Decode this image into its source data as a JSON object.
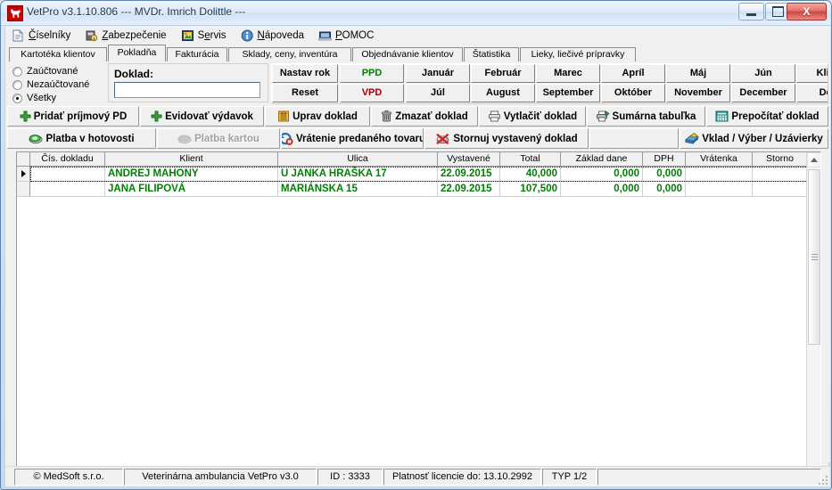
{
  "window": {
    "title": "VetPro v3.1.10.806 --- MVDr. Imrich Dolittle ---",
    "app_icon": "dog-icon",
    "minimize_label": "Minimize",
    "maximize_label": "Maximize",
    "close_label": "X"
  },
  "menu": [
    {
      "label": "Číselníky",
      "icon": "document-icon"
    },
    {
      "label": "Zabezpečenie",
      "icon": "lock-icon"
    },
    {
      "label": "Servis",
      "icon": "tools-icon"
    },
    {
      "label": "Nápoveda",
      "icon": "info-icon"
    },
    {
      "label": "POMOC",
      "icon": "monitor-icon"
    }
  ],
  "tabs": [
    {
      "label": "Kartotéka klientov",
      "active": false
    },
    {
      "label": "Pokladňa",
      "active": true
    },
    {
      "label": "Fakturácia",
      "active": false
    },
    {
      "label": "Sklady, ceny, inventúra",
      "active": false
    },
    {
      "label": "Objednávanie klientov",
      "active": false
    },
    {
      "label": "Štatistika",
      "active": false
    },
    {
      "label": "Lieky, liečivé prípravky",
      "active": false
    }
  ],
  "filter": {
    "options": [
      {
        "label": "Zaúčtované",
        "selected": false
      },
      {
        "label": "Nezaúčtované",
        "selected": false
      },
      {
        "label": "Všetky",
        "selected": true
      }
    ]
  },
  "doklad": {
    "label": "Doklad:",
    "value": "",
    "placeholder": ""
  },
  "grid_buttons": {
    "row1": [
      "Nastav rok",
      "PPD",
      "Január",
      "Február",
      "Marec",
      "Apríl",
      "Máj",
      "Jún",
      "Klien"
    ],
    "row2": [
      "Reset",
      "VPD",
      "Júl",
      "August",
      "September",
      "Október",
      "November",
      "December",
      "Deň"
    ],
    "ppd_color": "#008000",
    "vpd_color": "#a00000"
  },
  "toolbar1": [
    {
      "label": "Pridať príjmový PD",
      "icon": "plus-icon",
      "disabled": false
    },
    {
      "label": "Evidovať výdavok",
      "icon": "plus-icon",
      "disabled": false
    },
    {
      "label": "Uprav doklad",
      "icon": "edit-doc-icon",
      "disabled": false
    },
    {
      "label": "Zmazať doklad",
      "icon": "trash-icon",
      "disabled": false
    },
    {
      "label": "Vytlačiť doklad",
      "icon": "printer-icon",
      "disabled": false
    },
    {
      "label": "Sumárna tabuľka",
      "icon": "printer-green-icon",
      "disabled": false
    },
    {
      "label": "Prepočítať doklad",
      "icon": "calculator-icon",
      "disabled": false
    }
  ],
  "toolbar2": [
    {
      "label": "Platba v hotovosti",
      "icon": "cash-icon",
      "disabled": false
    },
    {
      "label": "Platba kartou",
      "icon": "card-icon",
      "disabled": true
    },
    {
      "label": "Vrátenie predaného tovaru",
      "icon": "return-icon",
      "disabled": false
    },
    {
      "label": "Stornuj vystavený doklad",
      "icon": "cancel-icon",
      "disabled": false
    },
    {
      "label": "",
      "icon": "",
      "disabled": false
    },
    {
      "label": "Vklad / Výber / Uzávierky",
      "icon": "money-icon",
      "disabled": false
    }
  ],
  "table": {
    "columns": [
      "Čís. dokladu",
      "Klient",
      "Ulica",
      "Vystavené",
      "Total",
      "Základ dane",
      "DPH",
      "Vrátenka",
      "Storno"
    ],
    "rows": [
      {
        "selected": true,
        "cis_dokladu": "",
        "klient": "ANDREJ MAHONY",
        "ulica": "U JANKA HRAŠKA 17",
        "vystavene": "22.09.2015",
        "total": "40,000",
        "zaklad_dane": "0,000",
        "dph": "0,000",
        "vratenka": "",
        "storno": ""
      },
      {
        "selected": false,
        "cis_dokladu": "",
        "klient": "JANA FILIPOVÁ",
        "ulica": "MARIÁNSKA 15",
        "vystavene": "22.09.2015",
        "total": "107,500",
        "zaklad_dane": "0,000",
        "dph": "0,000",
        "vratenka": "",
        "storno": ""
      }
    ],
    "row_text_color": "#008000"
  },
  "statusbar": [
    "© MedSoft s.r.o.",
    "Veterinárna ambulancia VetPro v3.0",
    "ID : 3333",
    "Platnosť licencie do: 13.10.2992",
    "TYP 1/2",
    ""
  ]
}
